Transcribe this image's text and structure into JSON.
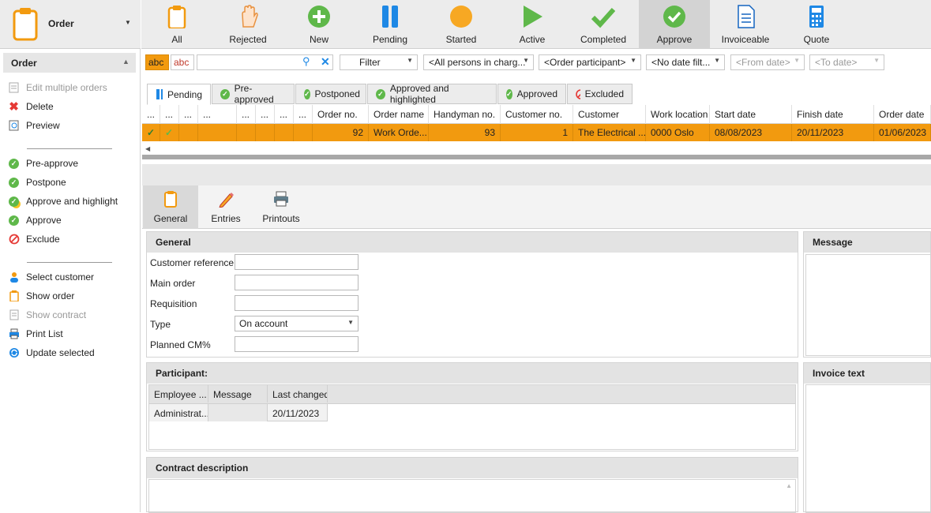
{
  "colors": {
    "accent": "#f29a0f",
    "green": "#5fb84a",
    "blue": "#1e88e5",
    "red": "#e53935",
    "yellow": "#f7a823"
  },
  "left": {
    "title": "Order",
    "section": "Order",
    "items": [
      {
        "label": "Edit multiple orders",
        "icon": "edit-multiple-icon",
        "disabled": true
      },
      {
        "label": "Delete",
        "icon": "delete-x-icon",
        "disabled": false
      },
      {
        "label": "Preview",
        "icon": "preview-icon",
        "disabled": false
      },
      {
        "label": "Pre-approve",
        "icon": "pre-approve-icon",
        "disabled": false
      },
      {
        "label": "Postpone",
        "icon": "postpone-icon",
        "disabled": false
      },
      {
        "label": "Approve and highlight",
        "icon": "approve-highlight-icon",
        "disabled": false
      },
      {
        "label": "Approve",
        "icon": "approve-icon",
        "disabled": false
      },
      {
        "label": "Exclude",
        "icon": "exclude-icon",
        "disabled": false
      },
      {
        "label": "Select customer",
        "icon": "person-icon",
        "disabled": false
      },
      {
        "label": "Show order",
        "icon": "clipboard-icon",
        "disabled": false
      },
      {
        "label": "Show contract",
        "icon": "contract-icon",
        "disabled": true
      },
      {
        "label": "Print List",
        "icon": "printer-icon",
        "disabled": false
      },
      {
        "label": "Update selected",
        "icon": "refresh-icon",
        "disabled": false
      }
    ]
  },
  "ribbon": [
    {
      "label": "All",
      "icon": "clipboard-icon"
    },
    {
      "label": "Rejected",
      "icon": "hand-stop-icon"
    },
    {
      "label": "New",
      "icon": "plus-circle-icon"
    },
    {
      "label": "Pending",
      "icon": "pause-icon"
    },
    {
      "label": "Started",
      "icon": "circle-icon"
    },
    {
      "label": "Active",
      "icon": "play-icon"
    },
    {
      "label": "Completed",
      "icon": "checkmark-icon"
    },
    {
      "label": "Approve",
      "icon": "check-circle-icon"
    },
    {
      "label": "Invoiceable",
      "icon": "invoice-doc-icon"
    },
    {
      "label": "Quote",
      "icon": "calculator-icon"
    }
  ],
  "filters": {
    "abc1": "abc",
    "abc2": "abc",
    "search_value": "",
    "filter": "Filter",
    "persons": "<All persons in charg...",
    "participant": "<Order participant>",
    "date_filter": "<No date filt...",
    "from_date": "<From date>",
    "to_date": "<To date>"
  },
  "tabs": [
    {
      "label": "Pending"
    },
    {
      "label": "Pre-approved"
    },
    {
      "label": "Postponed"
    },
    {
      "label": "Approved and highlighted"
    },
    {
      "label": "Approved"
    },
    {
      "label": "Excluded"
    }
  ],
  "grid": {
    "columns": [
      "...",
      "...",
      "...",
      "...",
      "...",
      "...",
      "...",
      "...",
      "Order no.",
      "Order name",
      "Handyman no.",
      "Customer no.",
      "Customer",
      "Work location",
      "Start date",
      "Finish date",
      "Order date"
    ],
    "row": {
      "order_no": "92",
      "order_name": "Work Orde...",
      "handyman_no": "93",
      "customer_no": "1",
      "customer": "The Electrical ...",
      "work_location": "0000 Oslo",
      "start_date": "08/08/2023",
      "finish_date": "20/11/2023",
      "order_date": "01/06/2023"
    }
  },
  "detail_tabs": [
    {
      "label": "General"
    },
    {
      "label": "Entries"
    },
    {
      "label": "Printouts"
    }
  ],
  "general": {
    "title": "General",
    "fields": [
      {
        "label": "Customer reference",
        "value": ""
      },
      {
        "label": "Main order",
        "value": ""
      },
      {
        "label": "Requisition",
        "value": ""
      },
      {
        "label": "Type",
        "value": "On account"
      },
      {
        "label": "Planned CM%",
        "value": ""
      }
    ]
  },
  "message": {
    "title": "Message"
  },
  "invoice_text": {
    "title": "Invoice text"
  },
  "participant": {
    "title": "Participant:",
    "columns": [
      "Employee ...",
      "Message",
      "Last changed"
    ],
    "row": [
      "Administrat...",
      "",
      "20/11/2023"
    ]
  },
  "contract": {
    "title": "Contract description"
  }
}
